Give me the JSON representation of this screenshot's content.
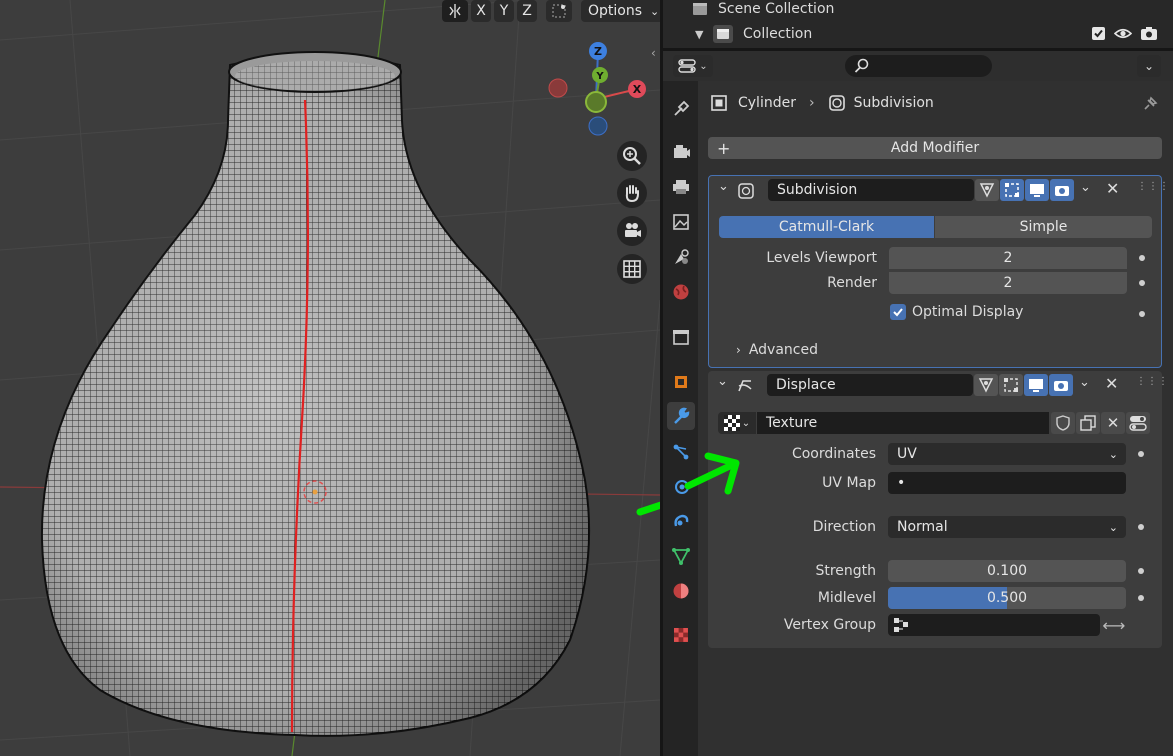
{
  "viewport": {
    "axes": [
      "X",
      "Y",
      "Z"
    ],
    "options_label": "Options",
    "gizmo": {
      "z": "Z",
      "y": "Y",
      "x": "X"
    }
  },
  "outliner": {
    "scene_collection": "Scene Collection",
    "collection": "Collection"
  },
  "breadcrumb": {
    "object": "Cylinder",
    "modifier": "Subdivision"
  },
  "add_modifier": "Add Modifier",
  "subdivision": {
    "name": "Subdivision",
    "modes": [
      "Catmull-Clark",
      "Simple"
    ],
    "active_mode": "Catmull-Clark",
    "levels_viewport_label": "Levels Viewport",
    "levels_viewport": "2",
    "render_label": "Render",
    "render": "2",
    "optimal_display": "Optimal Display",
    "optimal_display_checked": true,
    "advanced": "Advanced"
  },
  "displace": {
    "name": "Displace",
    "texture": "Texture",
    "coordinates_label": "Coordinates",
    "coordinates": "UV",
    "uv_map_label": "UV Map",
    "uv_map": "•",
    "direction_label": "Direction",
    "direction": "Normal",
    "strength_label": "Strength",
    "strength": "0.100",
    "midlevel_label": "Midlevel",
    "midlevel": "0.500",
    "midlevel_fraction": 0.5,
    "vertex_group_label": "Vertex Group"
  },
  "colors": {
    "accent": "#4772b3",
    "arrow": "#00e600",
    "seam": "#e02020"
  }
}
